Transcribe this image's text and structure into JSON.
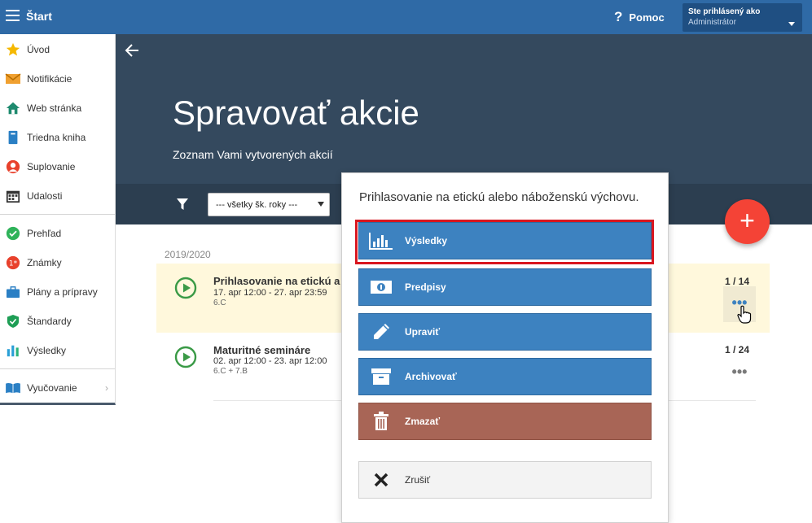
{
  "header": {
    "app_title": "Štart",
    "help_label": "Pomoc",
    "user_line1": "Ste prihlásený ako",
    "user_line2": "Administrátor"
  },
  "sidebar": {
    "items": [
      {
        "label": "Úvod",
        "icon": "star-icon"
      },
      {
        "label": "Notifikácie",
        "icon": "envelope-icon"
      },
      {
        "label": "Web stránka",
        "icon": "home-icon"
      },
      {
        "label": "Triedna kniha",
        "icon": "book-icon"
      },
      {
        "label": "Suplovanie",
        "icon": "substitute-icon"
      },
      {
        "label": "Udalosti",
        "icon": "calendar-icon"
      },
      {
        "label": "Prehľad",
        "icon": "check-circle-icon"
      },
      {
        "label": "Známky",
        "icon": "grades-icon"
      },
      {
        "label": "Plány a prípravy",
        "icon": "briefcase-icon"
      },
      {
        "label": "Štandardy",
        "icon": "shield-icon"
      },
      {
        "label": "Výsledky",
        "icon": "bar-chart-icon"
      },
      {
        "label": "Vyučovanie",
        "icon": "open-book-icon"
      }
    ]
  },
  "page": {
    "title": "Spravovať akcie",
    "subtitle": "Zoznam Vami vytvorených akcií",
    "year_filter": "--- všetky šk. roky ---",
    "year_label": "2019/2020"
  },
  "rows": [
    {
      "title": "Prihlasovanie na etickú a",
      "dates": "17. apr 12:00 - 27. apr 23:59",
      "classes": "6.C",
      "count": "1 / 14"
    },
    {
      "title": "Maturitné semináre",
      "dates": "02. apr 12:00 - 23. apr 12:00",
      "classes": "6.C + 7.B",
      "count": "1 / 24"
    }
  ],
  "more_label": "•••",
  "fab_label": "+",
  "popup": {
    "title": "Prihlasovanie na etickú alebo náboženskú výchovu.",
    "results": "Výsledky",
    "regulations": "Predpisy",
    "edit": "Upraviť",
    "archive": "Archivovať",
    "delete": "Zmazať",
    "cancel": "Zrušiť"
  },
  "colors": {
    "topbar": "#2f6aa6",
    "hero": "#34495e",
    "action_blue": "#3d82c0",
    "delete_brown": "#a86556",
    "fab_red": "#f44336",
    "highlight_row": "#fff8dc",
    "selection_outline": "#d9161f"
  }
}
